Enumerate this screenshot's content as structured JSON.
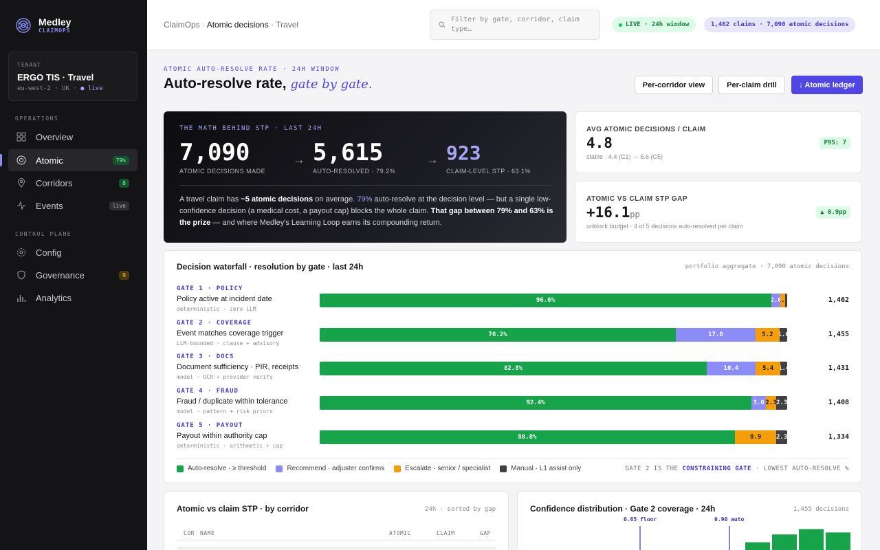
{
  "brand": {
    "name": "Medley",
    "sub": "CLAIMOPS"
  },
  "tenant": {
    "label": "TENANT",
    "name": "ERGO TIS · Travel",
    "region": "eu-west-2 · UK · ",
    "status": "● live"
  },
  "nav": {
    "operations_label": "OPERATIONS",
    "control_label": "CONTROL PLANE",
    "items": [
      {
        "label": "Overview",
        "icon": "grid-icon"
      },
      {
        "label": "Atomic",
        "icon": "target-icon",
        "badge": "79%"
      },
      {
        "label": "Corridors",
        "icon": "pin-icon",
        "badge": "8"
      },
      {
        "label": "Events",
        "icon": "pulse-icon",
        "badge": "live"
      },
      {
        "label": "Config",
        "icon": "gear-icon"
      },
      {
        "label": "Governance",
        "icon": "shield-icon",
        "badge": "9"
      },
      {
        "label": "Analytics",
        "icon": "bar-chart-icon"
      }
    ]
  },
  "topbar": {
    "crumb_1": "ClaimOps ·",
    "crumb_2": "Atomic decisions",
    "crumb_3": "· Travel",
    "search_placeholder": "Filter by gate, corridor, claim type…",
    "live_pill": "LIVE · 24h window",
    "count_pill": "1,462 claims · 7,090 atomic decisions"
  },
  "header": {
    "eyebrow": "ATOMIC AUTO-RESOLVE RATE · 24H WINDOW",
    "title": "Auto-resolve rate,",
    "title_em": "gate by gate.",
    "btn_corridor": "Per-corridor view",
    "btn_drill": "Per-claim drill",
    "btn_ledger": "↓ Atomic ledger"
  },
  "stp": {
    "label": "THE MATH BEHIND STP · LAST 24H",
    "n1": "7,090",
    "n1_sub": "ATOMIC DECISIONS MADE",
    "n2": "5,615",
    "n2_sub": "AUTO-RESOLVED · 79.2%",
    "n3": "923",
    "n3_sub": "CLAIM-LEVEL STP · 63.1%",
    "arrow": "→",
    "t1": "A travel claim has ",
    "t2": "~5 atomic decisions",
    "t3": " on average. ",
    "t4": "79%",
    "t5": " auto-resolve at the decision level — but a single low-confidence decision (a medical cost, a payout cap) blocks the whole claim. ",
    "t6": "That gap between 79% and 63% is the prize",
    "t7": " — and where Medley's Learning Loop earns its compounding return."
  },
  "metric1": {
    "label": "AVG ATOMIC DECISIONS / CLAIM",
    "value": "4.8",
    "note": "stable · 4.4 (C1) → 6.6 (C5)",
    "badge": "P95: 7"
  },
  "metric2": {
    "label": "ATOMIC VS CLAIM STP GAP",
    "value": "+16.1",
    "unit": "pp",
    "note": "unblock budget · 4 of 5 decisions auto-resolved per claim",
    "badge": "▲ 0.9pp"
  },
  "waterfall": {
    "title": "Decision waterfall · resolution by gate · last 24h",
    "meta": "portfolio aggregate · 7,090 atomic decisions",
    "colors": {
      "auto": "#16a34a",
      "recommend": "#8b8cf6",
      "escalate": "#f59e0b",
      "manual": "#3f3f46"
    },
    "gates": [
      {
        "tag": "GATE 1 · POLICY",
        "name": "Policy active at incident date",
        "sub": "deterministic · zero LLM",
        "count": "1,462",
        "segments": [
          {
            "v": 96.6,
            "label": "96.6%"
          },
          {
            "v": 2.0,
            "label": "2.0"
          },
          {
            "v": 1.0,
            "label": "1.0"
          },
          {
            "v": 0.4,
            "label": ""
          }
        ]
      },
      {
        "tag": "GATE 2 · COVERAGE",
        "name": "Event matches coverage trigger",
        "sub": "LLM-bounded · clause + advisory",
        "count": "1,455",
        "segments": [
          {
            "v": 76.2,
            "label": "76.2%"
          },
          {
            "v": 17.0,
            "label": "17.0"
          },
          {
            "v": 5.2,
            "label": "5.2"
          },
          {
            "v": 1.6,
            "label": "1.6"
          }
        ]
      },
      {
        "tag": "GATE 3 · DOCS",
        "name": "Document sufficiency · PIR, receipts",
        "sub": "model · OCR + provider verify",
        "count": "1,431",
        "segments": [
          {
            "v": 82.8,
            "label": "82.8%"
          },
          {
            "v": 10.4,
            "label": "10.4"
          },
          {
            "v": 5.4,
            "label": "5.4"
          },
          {
            "v": 1.4,
            "label": "1.4"
          }
        ]
      },
      {
        "tag": "GATE 4 · FRAUD",
        "name": "Fraud / duplicate within tolerance",
        "sub": "model · pattern + risk priors",
        "count": "1,408",
        "segments": [
          {
            "v": 92.4,
            "label": "92.4%"
          },
          {
            "v": 3.0,
            "label": "3.0"
          },
          {
            "v": 2.3,
            "label": "2.3"
          },
          {
            "v": 2.3,
            "label": "2.3"
          }
        ]
      },
      {
        "tag": "GATE 5 · PAYOUT",
        "name": "Payout within authority cap",
        "sub": "deterministic · arithmetic + cap",
        "count": "1,334",
        "segments": [
          {
            "v": 88.8,
            "label": "88.8%"
          },
          {
            "v": 0.0,
            "label": ""
          },
          {
            "v": 8.9,
            "label": "8.9"
          },
          {
            "v": 2.3,
            "label": "2.3"
          }
        ]
      }
    ],
    "legend": [
      "Auto-resolve · ≥ threshold",
      "Recommend · adjuster confirms",
      "Escalate · senior / specialist",
      "Manual · L1 assist only"
    ],
    "foot_1": "GATE 2 IS THE ",
    "foot_2": "CONSTRAINING GATE",
    "foot_3": " · LOWEST AUTO-RESOLVE %"
  },
  "corridor_card": {
    "title": "Atomic vs claim STP · by corridor",
    "meta": "24h · sorted by gap",
    "cols": [
      "COR",
      "NAME",
      "ATOMIC",
      "CLAIM",
      "GAP"
    ]
  },
  "conf_card": {
    "title": "Confidence distribution · Gate 2 coverage · 24h",
    "meta": "1,455 decisions",
    "floor_label": "0.65 floor",
    "auto_label": "0.90 auto",
    "bins": [
      0.08,
      0.42,
      0.66,
      0.82,
      0.72
    ]
  }
}
